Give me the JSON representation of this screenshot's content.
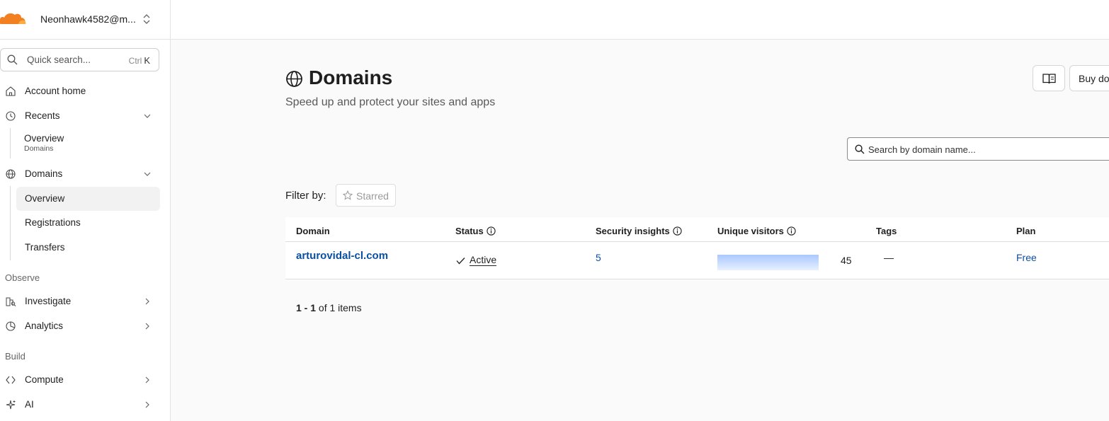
{
  "account": {
    "name": "Neonhawk4582@m...",
    "brand_color": "#f38020"
  },
  "search": {
    "placeholder": "Quick search...",
    "shortcut_prefix": "Ctrl",
    "shortcut_key": "K"
  },
  "sidebar": {
    "account_home": "Account home",
    "recents": {
      "label": "Recents",
      "items": [
        {
          "label": "Overview",
          "caption": "Domains"
        }
      ]
    },
    "domains": {
      "label": "Domains",
      "items": [
        {
          "label": "Overview"
        },
        {
          "label": "Registrations"
        },
        {
          "label": "Transfers"
        }
      ]
    },
    "section_observe": "Observe",
    "investigate": "Investigate",
    "analytics": "Analytics",
    "section_build": "Build",
    "compute": "Compute",
    "ai": "AI"
  },
  "main": {
    "title": "Domains",
    "subtitle": "Speed up and protect your sites and apps",
    "buy_button": "Buy domains",
    "domain_search_placeholder": "Search by domain name...",
    "filter_label": "Filter by:",
    "filter_starred": "Starred"
  },
  "table": {
    "headers": {
      "domain": "Domain",
      "status": "Status",
      "security": "Security insights",
      "visitors": "Unique visitors",
      "tags": "Tags",
      "plan": "Plan"
    },
    "rows": [
      {
        "domain": "arturovidal-cl.com",
        "status": "Active",
        "security_insights": "5",
        "unique_visitors": "45",
        "visitors_bar_fraction": 1.0,
        "tags": "—",
        "plan": "Free"
      }
    ]
  },
  "pagination": {
    "range": "1 - 1",
    "of_text": "of 1 items"
  }
}
